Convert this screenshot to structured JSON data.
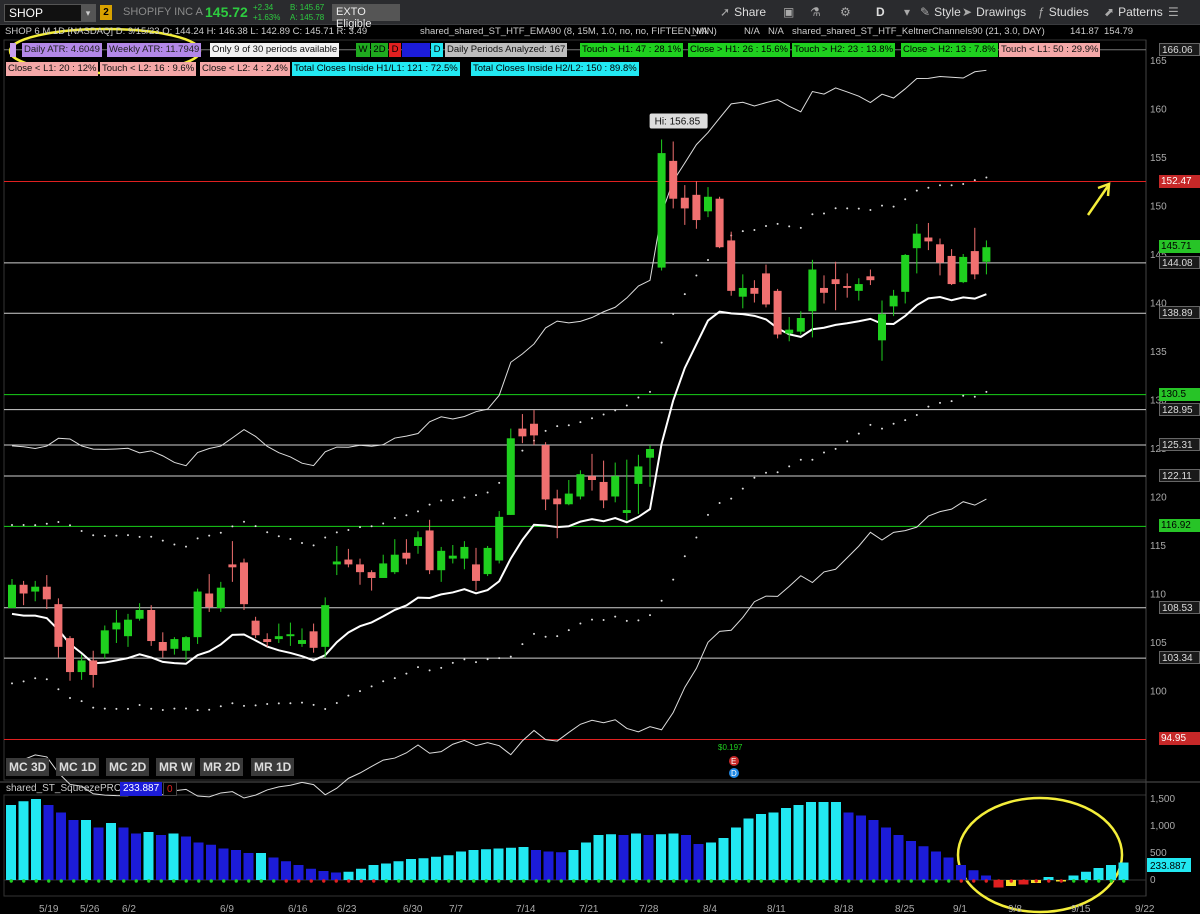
{
  "toolbar": {
    "symbol": "SHOP",
    "link_badge": "2",
    "company": "SHOPIFY INC A",
    "last": "145.72",
    "change": "+2.34",
    "change_pct": "+1.63%",
    "bid": "B: 145.67",
    "ask": "A: 145.78",
    "exto": "EXTO Eligible",
    "share": "Share",
    "period_letter": "D",
    "style": "Style",
    "drawings": "Drawings",
    "studies": "Studies",
    "patterns": "Patterns"
  },
  "header": {
    "chart_title": "SHOP 6 M 1D [NASDAQ]",
    "date": "D: 9/15/23",
    "open": "O: 144.24",
    "high": "H: 146.38",
    "low": "L: 142.89",
    "close": "C: 145.71",
    "range": "R: 3.49",
    "ema_study": "shared_shared_ST_HTF_EMA90 (8, 15M, 1.0, no, no, FIFTEEN_MIN)",
    "na1": "N/A",
    "na2": "N/A",
    "na3": "N/A",
    "keltner_study": "shared_shared_ST_HTF_KeltnerChannels90 (21, 3.0, DAY)",
    "k_low": "141.87",
    "k_mid": "154.79"
  },
  "stats_row1": {
    "daily_atr": "Daily ATR: 4.6049",
    "weekly_atr": "Weekly ATR: 11.7949",
    "periods": "Only 9 of 30 periods available",
    "w": "W",
    "d2": "2D",
    "d": "D",
    "d_blank": "",
    "d_last": "D",
    "analyzed": "Daily Periods Analyzed: 167",
    "touch_h1": "Touch > H1: 47 : 28.1%",
    "close_h1": "Close > H1: 26 : 15.6%",
    "touch_h2": "Touch > H2: 23 : 13.8%",
    "close_h2": "Close > H2: 13 : 7.8%",
    "touch_l1": "Touch < L1: 50 : 29.9%"
  },
  "stats_row2": {
    "close_l1": "Close < L1: 20 : 12%",
    "touch_l2": "Touch < L2: 16 : 9.6%",
    "close_l2": "Close < L2: 4 : 2.4%",
    "inside_h1l1": "Total Closes Inside H1/L1: 121 : 72.5%",
    "inside_h2l2": "Total Closes Inside H2/L2: 150 : 89.8%"
  },
  "price_axis": {
    "ticks": [
      "165",
      "160",
      "155",
      "150",
      "145",
      "140",
      "135",
      "130",
      "125",
      "120",
      "115",
      "110",
      "105",
      "100"
    ],
    "badges": [
      {
        "value": "166.06",
        "bg": "#1a1a1a",
        "fg": "#ddd"
      },
      {
        "value": "152.47",
        "bg": "#c62828",
        "fg": "#fff"
      },
      {
        "value": "145.71",
        "bg": "#27c427",
        "fg": "#000"
      },
      {
        "value": "144.08",
        "bg": "#1a1a1a",
        "fg": "#ddd"
      },
      {
        "value": "138.89",
        "bg": "#1a1a1a",
        "fg": "#ddd"
      },
      {
        "value": "130.5",
        "bg": "#27c427",
        "fg": "#000"
      },
      {
        "value": "128.95",
        "bg": "#1a1a1a",
        "fg": "#ddd"
      },
      {
        "value": "125.31",
        "bg": "#1a1a1a",
        "fg": "#ddd"
      },
      {
        "value": "122.11",
        "bg": "#1a1a1a",
        "fg": "#ddd"
      },
      {
        "value": "116.92",
        "bg": "#27c427",
        "fg": "#000"
      },
      {
        "value": "108.53",
        "bg": "#1a1a1a",
        "fg": "#ddd"
      },
      {
        "value": "103.34",
        "bg": "#1a1a1a",
        "fg": "#ddd"
      },
      {
        "value": "94.95",
        "bg": "#c62828",
        "fg": "#fff"
      }
    ]
  },
  "annotations": {
    "hi_label": "Hi: 156.85",
    "earnings_value": "$0.197",
    "earnings_e": "E",
    "earnings_d": "D"
  },
  "mc_buttons": [
    "MC 3D",
    "MC 1D",
    "MC 2D",
    "MR W",
    "MR 2D",
    "MR 1D"
  ],
  "squeeze": {
    "name": "shared_ST_SqueezePRO",
    "value": "233.887",
    "zero": "0",
    "axis_ticks": [
      "1,500",
      "1,000",
      "500",
      "0"
    ],
    "badge": "233.887"
  },
  "date_axis": [
    "5/19",
    "5/26",
    "6/2",
    "6/9",
    "6/16",
    "6/23",
    "6/30",
    "7/7",
    "7/14",
    "7/21",
    "7/28",
    "8/4",
    "8/11",
    "8/18",
    "8/25",
    "9/1",
    "9/8",
    "9/15",
    "9/22"
  ],
  "colors": {
    "up": "#1fd01f",
    "down": "#f07070",
    "red_level": "#e02020",
    "green_level": "#18d018",
    "white_level": "#cfcfcf",
    "ellipse": "#f4ee3a",
    "arrow": "#f4ee3a",
    "hist_cyan": "#22e8f2",
    "hist_blue": "#1c1cd8"
  },
  "chart_data": {
    "type": "candlestick",
    "title": "SHOP 6 M 1D [NASDAQ]",
    "dates": [
      "5/18",
      "5/19",
      "5/22",
      "5/23",
      "5/24",
      "5/25",
      "5/26",
      "5/30",
      "5/31",
      "6/1",
      "6/2",
      "6/5",
      "6/6",
      "6/7",
      "6/8",
      "6/9",
      "6/12",
      "6/13",
      "6/14",
      "6/15",
      "6/16",
      "6/20",
      "6/21",
      "6/22",
      "6/23",
      "6/26",
      "6/27",
      "6/28",
      "6/29",
      "6/30",
      "7/3",
      "7/5",
      "7/6",
      "7/7",
      "7/10",
      "7/11",
      "7/12",
      "7/13",
      "7/14",
      "7/17",
      "7/18",
      "7/19",
      "7/20",
      "7/21",
      "7/24",
      "7/25",
      "7/26",
      "7/27",
      "7/28",
      "7/31",
      "8/1",
      "8/2",
      "8/3",
      "8/4",
      "8/7",
      "8/8",
      "8/9",
      "8/10",
      "8/11",
      "8/14",
      "8/15",
      "8/16",
      "8/17",
      "8/18",
      "8/21",
      "8/22",
      "8/23",
      "8/24",
      "8/25",
      "8/28",
      "8/29",
      "8/30",
      "8/31",
      "9/1",
      "9/5",
      "9/6",
      "9/7",
      "9/8",
      "9/11",
      "9/12",
      "9/13",
      "9/14",
      "9/15"
    ],
    "ohlc": [
      [
        108.5,
        111.5,
        108.5,
        110.9
      ],
      [
        110.9,
        111.3,
        108.8,
        110.0
      ],
      [
        110.2,
        111.3,
        109.2,
        110.7
      ],
      [
        110.7,
        111.9,
        108.4,
        109.4
      ],
      [
        108.9,
        109.5,
        103.4,
        104.5
      ],
      [
        105.4,
        105.6,
        101.0,
        101.9
      ],
      [
        101.9,
        103.7,
        101.1,
        103.1
      ],
      [
        103.1,
        104.1,
        100.3,
        101.6
      ],
      [
        103.8,
        106.7,
        103.3,
        106.2
      ],
      [
        106.3,
        108.3,
        104.9,
        107.0
      ],
      [
        105.6,
        107.9,
        104.5,
        107.3
      ],
      [
        107.4,
        109.0,
        107.2,
        108.3
      ],
      [
        108.3,
        108.8,
        104.6,
        105.1
      ],
      [
        105.0,
        106.0,
        103.4,
        104.1
      ],
      [
        104.3,
        105.5,
        103.7,
        105.3
      ],
      [
        104.1,
        105.6,
        103.1,
        105.5
      ],
      [
        105.5,
        110.5,
        104.8,
        110.2
      ],
      [
        110.0,
        112.0,
        108.1,
        108.6
      ],
      [
        108.5,
        111.2,
        108.1,
        110.6
      ],
      [
        113.0,
        115.4,
        111.2,
        112.7
      ],
      [
        113.2,
        113.6,
        108.3,
        108.9
      ],
      [
        107.2,
        107.6,
        105.4,
        105.7
      ],
      [
        105.3,
        105.9,
        104.5,
        105.0
      ],
      [
        105.3,
        106.9,
        104.9,
        105.6
      ],
      [
        105.6,
        107.0,
        104.6,
        105.8
      ],
      [
        104.8,
        106.4,
        104.5,
        105.2
      ],
      [
        106.1,
        106.9,
        103.9,
        104.4
      ],
      [
        104.5,
        109.6,
        103.4,
        108.8
      ],
      [
        113.0,
        114.9,
        111.9,
        113.3
      ],
      [
        113.5,
        114.6,
        112.7,
        113.0
      ],
      [
        113.0,
        113.6,
        110.9,
        112.2
      ],
      [
        112.2,
        112.4,
        110.3,
        111.6
      ],
      [
        111.6,
        114.0,
        111.6,
        113.1
      ],
      [
        112.2,
        115.6,
        112.0,
        114.0
      ],
      [
        114.2,
        115.6,
        113.0,
        113.6
      ],
      [
        114.9,
        116.4,
        114.1,
        115.8
      ],
      [
        116.5,
        117.6,
        112.0,
        112.4
      ],
      [
        112.4,
        114.8,
        111.2,
        114.4
      ],
      [
        113.6,
        115.0,
        113.1,
        113.9
      ],
      [
        113.6,
        115.4,
        112.5,
        114.8
      ],
      [
        113.0,
        114.7,
        110.3,
        111.3
      ],
      [
        112.0,
        114.9,
        111.8,
        114.7
      ],
      [
        113.4,
        118.5,
        113.1,
        117.9
      ],
      [
        118.1,
        127.0,
        118.1,
        126.0
      ],
      [
        127.0,
        128.5,
        125.5,
        126.2
      ],
      [
        127.5,
        128.9,
        125.3,
        126.3
      ],
      [
        125.3,
        125.6,
        118.6,
        119.7
      ],
      [
        119.8,
        120.7,
        115.7,
        119.2
      ],
      [
        119.2,
        121.7,
        119.1,
        120.3
      ],
      [
        120.0,
        122.7,
        119.7,
        122.3
      ],
      [
        122.1,
        124.4,
        120.6,
        121.7
      ],
      [
        121.5,
        123.7,
        118.8,
        119.6
      ],
      [
        120.0,
        123.5,
        119.4,
        122.1
      ],
      [
        118.3,
        123.8,
        117.5,
        118.6
      ],
      [
        121.3,
        124.3,
        118.2,
        123.1
      ],
      [
        124.0,
        125.3,
        121.0,
        124.9
      ],
      [
        143.6,
        156.8,
        143.3,
        155.4
      ],
      [
        154.6,
        156.6,
        149.7,
        150.7
      ],
      [
        150.8,
        152.1,
        148.0,
        149.7
      ],
      [
        151.1,
        152.5,
        147.6,
        148.5
      ],
      [
        149.4,
        151.9,
        148.8,
        150.9
      ],
      [
        150.7,
        150.9,
        145.6,
        145.7
      ],
      [
        146.4,
        147.3,
        140.7,
        141.2
      ],
      [
        140.6,
        142.9,
        139.4,
        141.5
      ],
      [
        141.5,
        142.3,
        140.0,
        140.9
      ],
      [
        143.0,
        143.9,
        139.5,
        139.8
      ],
      [
        141.2,
        141.4,
        136.3,
        136.7
      ],
      [
        136.8,
        138.5,
        136.0,
        137.2
      ],
      [
        137.0,
        139.1,
        136.7,
        138.4
      ],
      [
        139.1,
        144.4,
        136.4,
        143.4
      ],
      [
        141.5,
        142.8,
        139.9,
        141.0
      ],
      [
        142.4,
        144.2,
        139.2,
        141.9
      ],
      [
        141.7,
        143.0,
        140.5,
        141.5
      ],
      [
        141.2,
        142.5,
        140.2,
        141.9
      ],
      [
        142.7,
        143.4,
        141.8,
        142.3
      ],
      [
        136.1,
        140.2,
        134.0,
        138.8
      ],
      [
        139.6,
        141.3,
        138.6,
        140.7
      ],
      [
        141.1,
        145.0,
        139.9,
        144.9
      ],
      [
        145.6,
        148.1,
        143.0,
        147.1
      ],
      [
        146.7,
        148.2,
        145.4,
        146.3
      ],
      [
        146.0,
        146.6,
        142.8,
        144.1
      ],
      [
        144.8,
        145.5,
        141.8,
        141.9
      ],
      [
        142.1,
        145.0,
        142.0,
        144.7
      ],
      [
        145.3,
        147.7,
        142.4,
        142.9
      ],
      [
        144.2,
        146.4,
        142.9,
        145.7
      ]
    ],
    "levels": [
      152.47,
      144.08,
      138.89,
      130.5,
      128.95,
      125.31,
      122.11,
      116.92,
      108.53,
      103.34,
      94.95
    ],
    "ylim": [
      93,
      166
    ],
    "squeeze_hist": [
      1000,
      1050,
      1080,
      1000,
      900,
      800,
      800,
      700,
      760,
      700,
      620,
      640,
      600,
      620,
      580,
      500,
      470,
      420,
      400,
      360,
      360,
      300,
      250,
      200,
      150,
      120,
      100,
      110,
      150,
      200,
      220,
      250,
      280,
      290,
      310,
      330,
      380,
      400,
      410,
      420,
      430,
      440,
      400,
      380,
      370,
      400,
      500,
      600,
      610,
      600,
      620,
      600,
      610,
      620,
      600,
      480,
      500,
      560,
      700,
      820,
      880,
      900,
      960,
      1000,
      1040,
      1040,
      1040,
      900,
      860,
      800,
      700,
      600,
      520,
      450,
      380,
      300,
      200,
      130,
      60,
      -100,
      -80,
      -60,
      -40,
      40,
      -20,
      60,
      110,
      160,
      200,
      233
    ],
    "xlabel": "",
    "ylabel": ""
  }
}
